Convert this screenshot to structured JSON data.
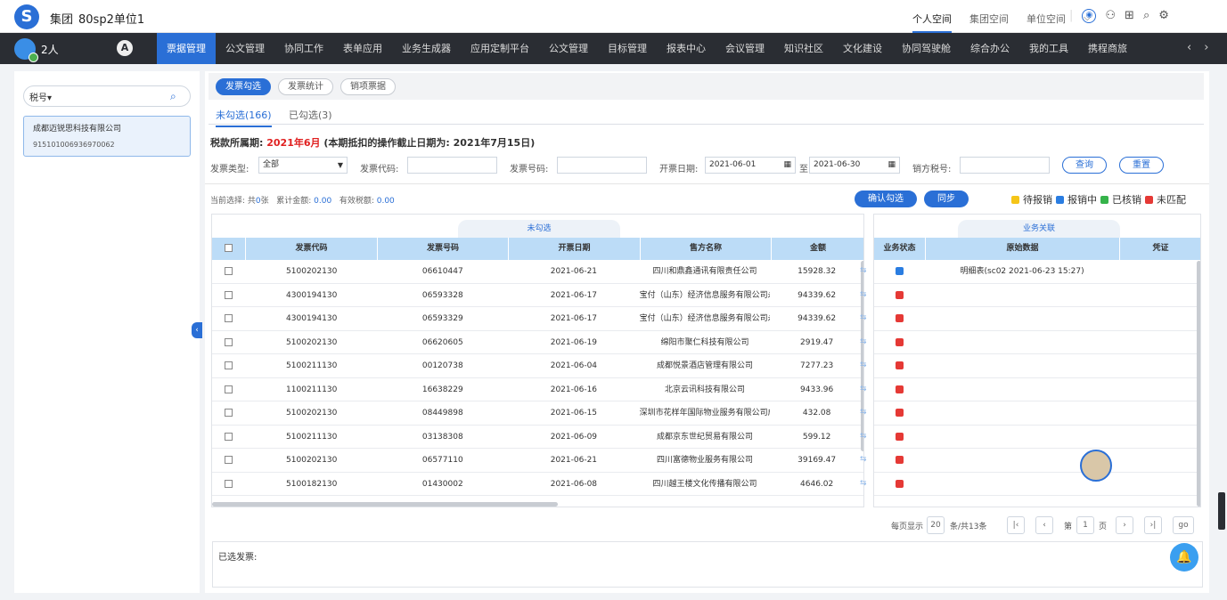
{
  "header": {
    "logo": "S",
    "org": "集团",
    "unit": "80sp2单位1",
    "spaces": [
      "个人空间",
      "集团空间",
      "单位空间"
    ],
    "icons": [
      "chevron-down-icon",
      "org-icon",
      "user-icon",
      "apps-icon",
      "search-icon",
      "settings-icon"
    ]
  },
  "nav": {
    "user_count": "2人",
    "badge": "A",
    "menu": [
      "票据管理",
      "公文管理",
      "协同工作",
      "表单应用",
      "业务生成器",
      "应用定制平台",
      "公文管理",
      "目标管理",
      "报表中心",
      "会议管理",
      "知识社区",
      "文化建设",
      "协同驾驶舱",
      "综合办公",
      "我的工具",
      "携程商旅"
    ],
    "active_index": 0,
    "prev": "‹",
    "next": "›"
  },
  "left": {
    "search_select": "税号▾",
    "search_placeholder": "",
    "company_name": "成都迈锐思科技有限公司",
    "company_code": "915101006936970062",
    "collapse": "‹"
  },
  "main": {
    "top_tabs": [
      "发票勾选",
      "发票统计",
      "销项票据"
    ],
    "sub_tabs": [
      "未勾选(166)",
      "已勾选(3)"
    ],
    "period_label": "税款所属期:",
    "period_value": "2021年6月",
    "period_note": "(本期抵扣的操作截止日期为: 2021年7月15日)",
    "filters": {
      "invoice_type_label": "发票类型:",
      "invoice_type_value": "全部",
      "invoice_code_label": "发票代码:",
      "invoice_no_label": "发票号码:",
      "date_label": "开票日期:",
      "date_from": "2021-06-01",
      "date_to_label": "至",
      "date_to": "2021-06-30",
      "seller_tax_label": "销方税号:",
      "query": "查询",
      "reset": "重置"
    },
    "summary": {
      "prefix": "当前选择: 共",
      "count": "0",
      "count_unit": "张",
      "total_label": "累计金额:",
      "total": "0.00",
      "tax_label": "有效税额:",
      "tax": "0.00"
    },
    "confirm": "确认勾选",
    "sync": "同步",
    "legend": [
      {
        "label": "待报销",
        "color": "#f5c518"
      },
      {
        "label": "报销中",
        "color": "#2a7de1"
      },
      {
        "label": "已核销",
        "color": "#35b34a"
      },
      {
        "label": "未匹配",
        "color": "#e53935"
      }
    ],
    "left_table": {
      "title": "未勾选",
      "columns": [
        "发票代码",
        "发票号码",
        "开票日期",
        "售方名称",
        "金额"
      ],
      "rows": [
        [
          "5100202130",
          "06610447",
          "2021-06-21",
          "四川和鼎鑫通讯有限责任公司",
          "15928.32"
        ],
        [
          "4300194130",
          "06593328",
          "2021-06-17",
          "宝付（山东）经济信息服务有限公司永",
          "94339.62"
        ],
        [
          "4300194130",
          "06593329",
          "2021-06-17",
          "宝付（山东）经济信息服务有限公司永",
          "94339.62"
        ],
        [
          "5100202130",
          "06620605",
          "2021-06-19",
          "绵阳市聚仁科技有限公司",
          "2919.47"
        ],
        [
          "5100211130",
          "00120738",
          "2021-06-04",
          "成都悦景酒店管理有限公司",
          "7277.23"
        ],
        [
          "1100211130",
          "16638229",
          "2021-06-16",
          "北京云讯科技有限公司",
          "9433.96"
        ],
        [
          "5100202130",
          "08449898",
          "2021-06-15",
          "深圳市花样年国际物业服务有限公司成",
          "432.08"
        ],
        [
          "5100211130",
          "03138308",
          "2021-06-09",
          "成都京东世纪贸易有限公司",
          "599.12"
        ],
        [
          "5100202130",
          "06577110",
          "2021-06-21",
          "四川富德物业服务有限公司",
          "39169.47"
        ],
        [
          "5100182130",
          "01430002",
          "2021-06-08",
          "四川越王楼文化传播有限公司",
          "4646.02"
        ]
      ]
    },
    "right_table": {
      "title": "业务关联",
      "columns": [
        "业务状态",
        "原始数据",
        "凭证"
      ],
      "rows": [
        {
          "status": "#2a7de1",
          "data": "明细表(sc02 2021-06-23 15:27)"
        },
        {
          "status": "#e53935",
          "data": ""
        },
        {
          "status": "#e53935",
          "data": ""
        },
        {
          "status": "#e53935",
          "data": ""
        },
        {
          "status": "#e53935",
          "data": ""
        },
        {
          "status": "#e53935",
          "data": ""
        },
        {
          "status": "#e53935",
          "data": ""
        },
        {
          "status": "#e53935",
          "data": ""
        },
        {
          "status": "#e53935",
          "data": ""
        },
        {
          "status": "#e53935",
          "data": ""
        }
      ]
    },
    "pager": {
      "per_page_label": "每页显示",
      "per_page": "20",
      "total_label": "条/共13条",
      "first": "|‹",
      "prev": "‹",
      "page_prefix": "第",
      "page": "1",
      "page_suffix": "页",
      "next": "›",
      "last": "›|",
      "go": "go"
    },
    "selected_label": "已选发票:"
  },
  "float": {
    "bell": "🔔"
  }
}
